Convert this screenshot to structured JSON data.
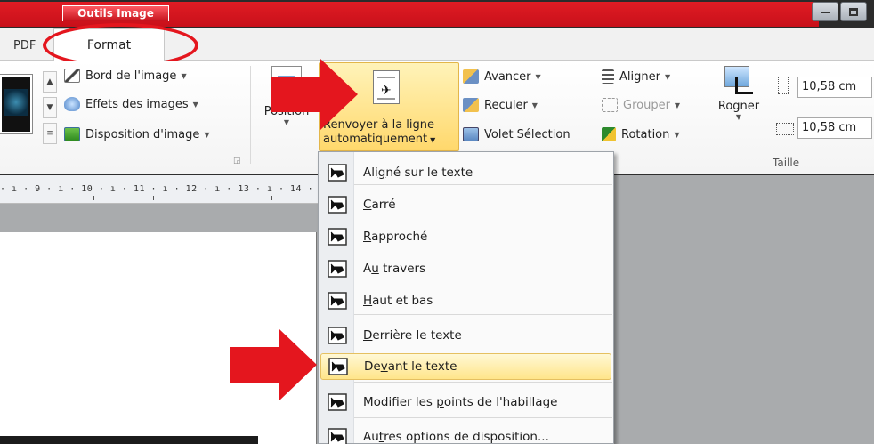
{
  "window": {
    "contextual_tab_group": "Outils Image"
  },
  "tabs": {
    "pdf": "PDF",
    "format": "Format"
  },
  "ribbon": {
    "styles": {
      "border_label": "Bord de l'image",
      "effects_label": "Effets des images",
      "layout_label": "Disposition d'image"
    },
    "arrange": {
      "position_label": "Position",
      "wrap_label_line1": "Renvoyer à la ligne",
      "wrap_label_line2": "automatiquement",
      "forward_label": "Avancer",
      "backward_label": "Reculer",
      "selection_pane_label": "Volet Sélection",
      "align_label": "Aligner",
      "group_label": "Grouper",
      "rotate_label": "Rotation"
    },
    "size": {
      "crop_label": "Rogner",
      "height_value": "10,58 cm",
      "width_value": "10,58 cm",
      "group_title": "Taille"
    }
  },
  "ruler": {
    "text": "· ı · 9 · ı · 10 · ı · 11 · ı · 12 · ı · 13 · ı · 14 · ı"
  },
  "wrap_menu": {
    "items": [
      {
        "before": "Ali",
        "accel": "g",
        "after": "né sur le texte",
        "icon": "wrap-inline-icon"
      },
      {
        "before": "",
        "accel": "C",
        "after": "arré",
        "icon": "wrap-square-icon"
      },
      {
        "before": "",
        "accel": "R",
        "after": "approché",
        "icon": "wrap-tight-icon"
      },
      {
        "before": "A",
        "accel": "u",
        "after": " travers",
        "icon": "wrap-through-icon"
      },
      {
        "before": "",
        "accel": "H",
        "after": "aut et bas",
        "icon": "wrap-top-bottom-icon"
      },
      {
        "before": "",
        "accel": "D",
        "after": "errière le texte",
        "icon": "wrap-behind-icon"
      },
      {
        "before": "De",
        "accel": "v",
        "after": "ant le texte",
        "icon": "wrap-in-front-icon"
      },
      {
        "before": "Modifier les ",
        "accel": "p",
        "after": "oints de l'habillage",
        "icon": "edit-wrap-points-icon"
      },
      {
        "before": "Au",
        "accel": "t",
        "after": "res options de disposition...",
        "icon": "more-layout-options-icon"
      }
    ]
  },
  "colors": {
    "annotation_red": "#e4161e",
    "contextual_red": "#d0121c",
    "highlight_yellow": "#ffe58a"
  }
}
